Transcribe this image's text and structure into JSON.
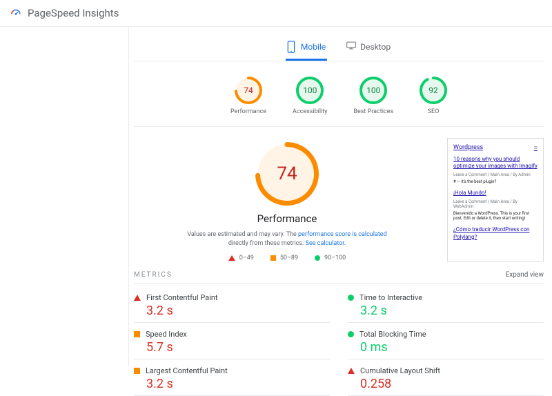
{
  "header": {
    "title": "PageSpeed Insights"
  },
  "tabs": {
    "mobile": "Mobile",
    "desktop": "Desktop"
  },
  "scores": {
    "performance": {
      "value": "74",
      "label": "Performance",
      "color": "#fb8c00",
      "bg": "#fff4e5",
      "pct": 74
    },
    "accessibility": {
      "value": "100",
      "label": "Accessibility",
      "color": "#0cce6b",
      "bg": "#e6f8ee",
      "pct": 100
    },
    "best_practices": {
      "value": "100",
      "label": "Best Practices",
      "color": "#0cce6b",
      "bg": "#e6f8ee",
      "pct": 100
    },
    "seo": {
      "value": "92",
      "label": "SEO",
      "color": "#0cce6b",
      "bg": "#e6f8ee",
      "pct": 92
    }
  },
  "performance_panel": {
    "value": "74",
    "title": "Performance",
    "desc_prefix": "Values are estimated and may vary. The ",
    "desc_link1": "performance score is calculated",
    "desc_mid": " directly from these metrics. ",
    "desc_link2": "See calculator.",
    "legend": {
      "r0": "0–49",
      "r1": "50–89",
      "r2": "90–100"
    }
  },
  "preview": {
    "site": "Wordpress",
    "s1_title": "10 reasons why you should optimize your images with Imagify",
    "s1_meta": "Leave a Comment / Main Area / By Admin",
    "s1_meta2": "# — it's the best plugin?",
    "s2_title": "¡Hola Mundo!",
    "s2_meta": "Leave a Comment / Main Area / By WebAdmin",
    "s2_meta2": "Bienvenido a WordPress. This is your first post. Edit or delete it, then start writing!",
    "s3_title": "¿Cómo traducir WordPress con Polylang?"
  },
  "metrics": {
    "heading": "METRICS",
    "expand": "Expand view",
    "fcp": {
      "name": "First Contentful Paint",
      "value": "3.2 s"
    },
    "tti": {
      "name": "Time to Interactive",
      "value": "3.2 s"
    },
    "si": {
      "name": "Speed Index",
      "value": "5.7 s"
    },
    "tbt": {
      "name": "Total Blocking Time",
      "value": "0 ms"
    },
    "lcp": {
      "name": "Largest Contentful Paint",
      "value": "3.2 s"
    },
    "cls": {
      "name": "Cumulative Layout Shift",
      "value": "0.258"
    }
  }
}
